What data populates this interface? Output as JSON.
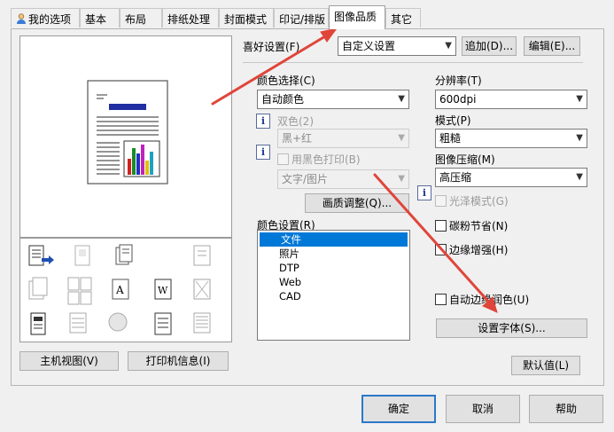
{
  "tabs": [
    {
      "label": "我的选项",
      "icon": "user-icon"
    },
    {
      "label": "基本"
    },
    {
      "label": "布局"
    },
    {
      "label": "排纸处理"
    },
    {
      "label": "封面模式"
    },
    {
      "label": "印记/排版"
    },
    {
      "label": "图像品质",
      "active": true
    },
    {
      "label": "其它"
    }
  ],
  "favorites": {
    "label": "喜好设置(F)",
    "value": "自定义设置",
    "add": "追加(D)...",
    "edit": "编辑(E)..."
  },
  "left_buttons": {
    "host_view": "主机视图(V)",
    "printer_info": "打印机信息(I)"
  },
  "color": {
    "select_label": "颜色选择(C)",
    "select_value": "自动颜色",
    "dual_label": "双色(2)",
    "dual_value": "黑+红",
    "black_print": "用黑色打印(B)",
    "black_value": "文字/图片",
    "quality_button": "画质调整(Q)...",
    "setting_label": "颜色设置(R)",
    "setting_items": [
      "文件",
      "照片",
      "DTP",
      "Web",
      "CAD"
    ],
    "setting_selected": "文件"
  },
  "right": {
    "resolution_label": "分辨率(T)",
    "resolution_value": "600dpi",
    "mode_label": "模式(P)",
    "mode_value": "粗糙",
    "compress_label": "图像压缩(M)",
    "compress_value": "高压缩",
    "gloss": "光泽模式(G)",
    "toner_save": "碳粉节省(N)",
    "edge_enhance": "边缘增强(H)",
    "auto_trap": "自动边缘润色(U)",
    "font_button": "设置字体(S)..."
  },
  "default_button": "默认值(L)",
  "footer": {
    "ok": "确定",
    "cancel": "取消",
    "help": "帮助"
  },
  "arrow_color": "#e0453a",
  "accent": "#0078d7"
}
